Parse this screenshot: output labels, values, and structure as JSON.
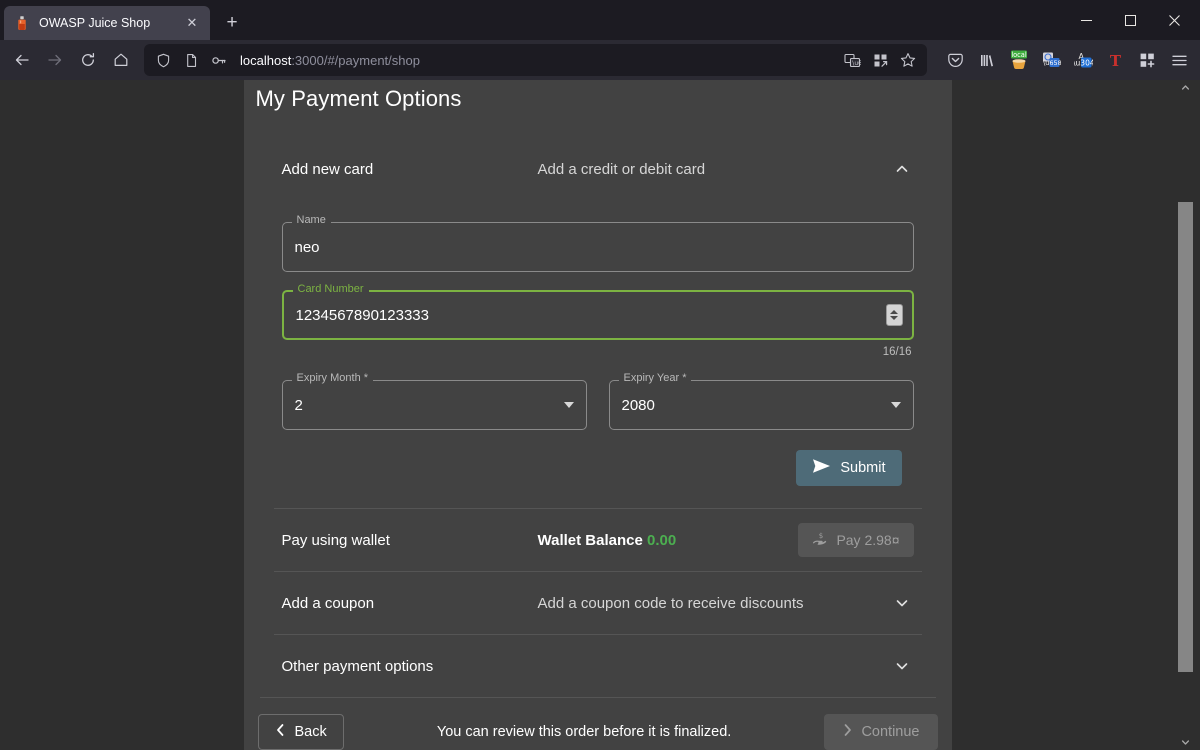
{
  "browser": {
    "tab": {
      "title": "OWASP Juice Shop",
      "favicon_icon": "juice-bottle-icon",
      "close_icon": "✕"
    },
    "new_tab_label": "+",
    "window_controls": {
      "minimize": "minimize-icon",
      "maximize": "maximize-icon",
      "close": "close-icon"
    },
    "nav": {
      "back_icon": "arrow-left-icon",
      "forward_icon": "arrow-right-icon",
      "reload_icon": "reload-icon",
      "home_icon": "home-icon"
    },
    "urlbar": {
      "shield_icon": "shield-icon",
      "page_icon": "page-icon",
      "permission_icon": "key-icon",
      "host": "localhost",
      "path": ":3000/#/payment/shop",
      "translate_icon": "translate-icon",
      "extensions_icon": "extensions-grid-icon",
      "bookmark_icon": "star-icon"
    },
    "toolbar_right": [
      {
        "name": "pocket-icon",
        "glyph": "Ⓥ"
      },
      {
        "name": "library-icon",
        "glyph": "|||\\"
      },
      {
        "name": "local-storage-extension-icon",
        "badge": "local"
      },
      {
        "name": "translate-extension-icon",
        "glyph": ""
      },
      {
        "name": "japanese-translate-extension-icon",
        "glyph": ""
      },
      {
        "name": "tampermonkey-icon",
        "glyph": "T"
      },
      {
        "name": "extensions-puzzle-icon",
        "glyph": ""
      },
      {
        "name": "app-menu-icon",
        "glyph": "☰"
      }
    ]
  },
  "page": {
    "title": "My Payment Options",
    "add_card": {
      "title": "Add new card",
      "description": "Add a credit or debit card",
      "chevron_icon": "chevron-up-icon",
      "fields": {
        "name": {
          "legend": "Name",
          "value": "neo"
        },
        "card_number": {
          "legend": "Card Number",
          "value": "1234567890123333",
          "counter": "16/16",
          "spinner_icon": "number-spinner-icon"
        },
        "expiry_month": {
          "legend": "Expiry Month *",
          "value": "2",
          "arrow_icon": "select-arrow-icon"
        },
        "expiry_year": {
          "legend": "Expiry Year *",
          "value": "2080",
          "arrow_icon": "select-arrow-icon"
        }
      },
      "submit": {
        "label": "Submit",
        "icon": "send-icon",
        "color": "#4e6b78"
      }
    },
    "wallet": {
      "title": "Pay using wallet",
      "balance_label": "Wallet Balance",
      "balance_value": "0.00",
      "balance_color": "#4caf50",
      "pay_button": {
        "label": "Pay 2.98¤",
        "icon": "hand-money-icon",
        "disabled": true
      }
    },
    "coupon": {
      "title": "Add a coupon",
      "description": "Add a coupon code to receive discounts",
      "chevron_icon": "chevron-down-icon"
    },
    "other": {
      "title": "Other payment options",
      "description": "",
      "chevron_icon": "chevron-down-icon"
    },
    "footer": {
      "back": {
        "label": "Back",
        "icon": "chevron-left-icon"
      },
      "note": "You can review this order before it is finalized.",
      "continue": {
        "label": "Continue",
        "icon": "chevron-right-icon",
        "disabled": true
      }
    }
  },
  "scrollbar": {
    "up_icon": "scroll-up-icon",
    "down_icon": "scroll-down-icon"
  }
}
